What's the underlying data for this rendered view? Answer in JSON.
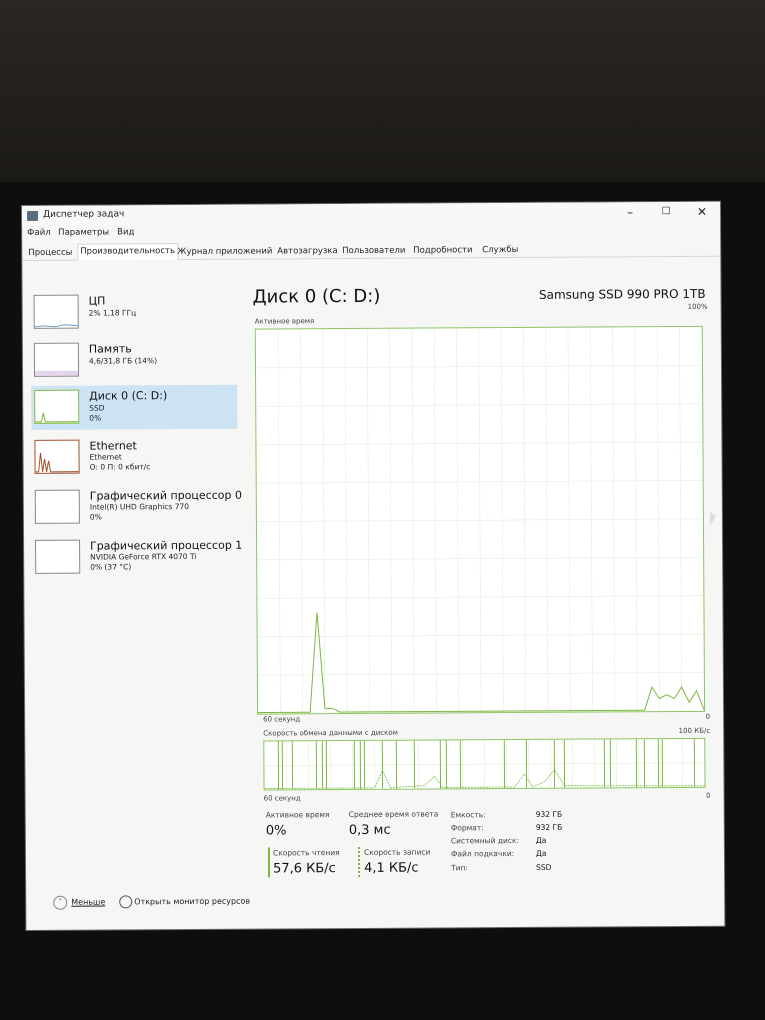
{
  "window": {
    "title": "Диспетчер задач",
    "minimize": "–",
    "maximize": "☐",
    "close": "✕"
  },
  "menu": [
    "Файл",
    "Параметры",
    "Вид"
  ],
  "tabs": [
    "Процессы",
    "Производительность",
    "Журнал приложений",
    "Автозагрузка",
    "Пользователи",
    "Подробности",
    "Службы"
  ],
  "active_tab": "Производительность",
  "sidebar": [
    {
      "title": "ЦП",
      "line1": "2% 1,18 ГГц",
      "line2": ""
    },
    {
      "title": "Память",
      "line1": "4,6/31,8 ГБ (14%)",
      "line2": ""
    },
    {
      "title": "Диск 0 (C: D:)",
      "line1": "SSD",
      "line2": "0%"
    },
    {
      "title": "Ethernet",
      "line1": "Ethernet",
      "line2": "О: 0 П: 0 кбит/с"
    },
    {
      "title": "Графический процессор 0",
      "line1": "Intel(R) UHD Graphics 770",
      "line2": "0%"
    },
    {
      "title": "Графический процессор 1",
      "line1": "NVIDIA GeForce RTX 4070 Ti",
      "line2": "0% (37 °C)"
    }
  ],
  "main": {
    "title": "Диск 0 (C: D:)",
    "model": "Samsung SSD 990 PRO 1TB",
    "active_time_label": "Активное время",
    "active_time_max": "100%",
    "axis_60s": "60 секунд",
    "axis_zero": "0",
    "transfer_label": "Скорость обмена данными с диском",
    "transfer_max": "100 КБ/с"
  },
  "stats": {
    "active_time_label": "Активное время",
    "active_time_value": "0%",
    "avg_response_label": "Среднее время ответа",
    "avg_response_value": "0,3 мс",
    "read_label": "Скорость чтения",
    "read_value": "57,6 КБ/с",
    "write_label": "Скорость записи",
    "write_value": "4,1 КБ/с"
  },
  "properties": [
    {
      "key": "Емкость:",
      "value": "932 ГБ"
    },
    {
      "key": "Формат:",
      "value": "932 ГБ"
    },
    {
      "key": "Системный диск:",
      "value": "Да"
    },
    {
      "key": "Файл подкачки:",
      "value": "Да"
    },
    {
      "key": "Тип:",
      "value": "SSD"
    }
  ],
  "footer": {
    "less": "Меньше",
    "open_monitor": "Открыть монитор ресурсов"
  },
  "colors": {
    "disk_line": "#7cb83e",
    "disk_border": "#8cc464",
    "ethernet": "#a0522d",
    "selection": "#cde3f3"
  },
  "icons": [
    "app-icon",
    "chevron-up-icon",
    "resource-monitor-icon"
  ],
  "active_time_series": [
    0,
    0,
    0,
    0,
    0,
    0,
    0,
    0,
    26,
    1,
    1,
    0,
    0,
    0,
    0,
    0,
    0,
    0,
    0,
    0,
    0,
    0,
    0,
    0,
    0,
    0,
    0,
    0,
    0,
    0,
    0,
    0,
    0,
    0,
    0,
    0,
    0,
    0,
    0,
    0,
    0,
    0,
    0,
    0,
    0,
    0,
    0,
    0,
    0,
    0,
    0,
    0,
    0,
    6,
    3,
    4,
    3,
    6,
    2,
    5,
    0
  ]
}
